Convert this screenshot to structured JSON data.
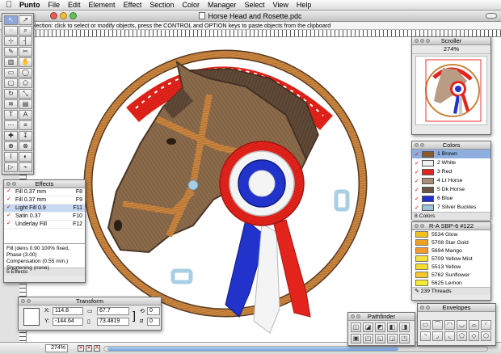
{
  "menubar": {
    "app": "Punto",
    "items": [
      "File",
      "Edit",
      "Element",
      "Effect",
      "Section",
      "Color",
      "Manager",
      "Select",
      "View",
      "Help"
    ]
  },
  "window": {
    "title": "Horse Head and Rosette.pdc",
    "status": "Selection: click to select or modify objects, press the CONTROL and OPTION keys to paste objects from the clipboard",
    "zoom": "274%"
  },
  "effects": {
    "title": "Effects",
    "rows": [
      {
        "label": "Fill 0.37 mm",
        "key": "F8",
        "selected": false
      },
      {
        "label": "Fill 0.37 mm",
        "key": "F9",
        "selected": false
      },
      {
        "label": "Light Fill 0.9",
        "key": "F11",
        "selected": true
      },
      {
        "label": "Satin 0.37",
        "key": "F10",
        "selected": false
      },
      {
        "label": "Underlay Fill",
        "key": "F12",
        "selected": false
      }
    ],
    "info": [
      "Fill (dens 0.90 100% fixed,",
      "Phase (3.00)",
      "Compensation (0.55 mm.)",
      "Shortening (none)"
    ],
    "count": "5 Effects"
  },
  "transform": {
    "title": "Transform",
    "x_label": "X:",
    "x": "114.8",
    "y_label": "Y:",
    "y": "-144.64",
    "w": "67.7",
    "h": "73.4819",
    "rotate": "0",
    "skew": "0"
  },
  "scroller": {
    "title": "Scroller",
    "zoom": "274%"
  },
  "colors": {
    "title": "Colors",
    "rows": [
      {
        "label": "1 Brown",
        "color": "#8a5a2b",
        "selected": true
      },
      {
        "label": "2 White",
        "color": "#f2f2f2",
        "selected": false
      },
      {
        "label": "3 Red",
        "color": "#e0261f",
        "selected": false
      },
      {
        "label": "4 Lt Horse",
        "color": "#a88f77",
        "selected": false
      },
      {
        "label": "5 Dk Horse",
        "color": "#6b5442",
        "selected": false
      },
      {
        "label": "6 Blue",
        "color": "#1f2fd0",
        "selected": false
      },
      {
        "label": "7 Silver Buckles",
        "color": "#9ec4dc",
        "selected": false
      }
    ],
    "count": "8 Colors"
  },
  "threads": {
    "title": "R-A SBP-6 #122",
    "rows": [
      {
        "label": "5534 Glow",
        "color": "#f3c21a"
      },
      {
        "label": "5708 Star Gold",
        "color": "#f0a020"
      },
      {
        "label": "5694 Mango",
        "color": "#f49a2a"
      },
      {
        "label": "5709 Yellow Mist",
        "color": "#f6e23a"
      },
      {
        "label": "5513 Yellow",
        "color": "#f7dd28"
      },
      {
        "label": "5762 Sunflower",
        "color": "#f7c72a"
      },
      {
        "label": "5625 Lemon",
        "color": "#f8ec2e"
      }
    ],
    "count": "239 Threads"
  },
  "pathfinder": {
    "title": "Pathfinder",
    "buttons": [
      "◫",
      "◪",
      "◩",
      "◧",
      "◨",
      "▣",
      "◰",
      "◱",
      "◲",
      "◳"
    ]
  },
  "envelopes": {
    "title": "Envelopes",
    "buttons": [
      "▭",
      "⌒",
      "◠",
      "◡",
      "⌓",
      "◜",
      "◝",
      "◞",
      "◟",
      "⬠",
      "◇",
      "⬡"
    ]
  },
  "design_colors": {
    "brown": "#8a6a4a",
    "dark": "#5a4432",
    "red": "#e3241c",
    "blue": "#2233cc",
    "white": "#f4f4f4",
    "buckle": "#a9cfe4",
    "strap": "#c9853f"
  }
}
